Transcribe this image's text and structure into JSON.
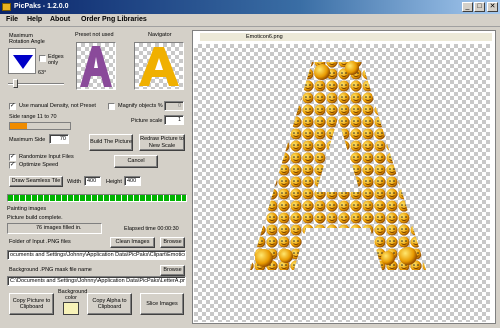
{
  "window": {
    "title": "PicPaks - 1.2.0.0",
    "min": "_",
    "max": "□",
    "close": "✕"
  },
  "menu": [
    "File",
    "Help",
    "About",
    "Order Png Libraries"
  ],
  "rotation": {
    "label": "Maximum Rotation Angle",
    "value": "63°",
    "edges_only": "Edges only"
  },
  "preset": {
    "label": "Preset not used"
  },
  "navigator": {
    "label": "Navigator"
  },
  "options": {
    "manual_density": "Use manual Density, not Preset",
    "magnify": "Magnify objects %",
    "magnify_value": "0",
    "side_range": "Side range 11 to 70",
    "picture_scale_label": "Picture scale",
    "picture_scale_value": "1",
    "max_side_label": "Maximum Side",
    "max_side_value": "70",
    "randomize": "Randomize Input Files",
    "optimize": "Optimize Speed",
    "side_range_fill": 0.28
  },
  "buttons": {
    "build": "Build The Picture",
    "redraw": "Redraw Picture to New Scale",
    "cancel": "Cancel",
    "seamless": "Draw Seamless Tile",
    "clean": "Clean Images",
    "browse1": "Browse",
    "browse2": "Browse",
    "copy_picture": "Copy Picture to Clipboard",
    "copy_alpha": "Copy Alpha to Clipboard",
    "slice": "Slice Images"
  },
  "tile": {
    "width_label": "Width",
    "width_value": "400",
    "height_label": "Height",
    "height_value": "400"
  },
  "status": {
    "painting": "Painting images",
    "complete": "Picture build complete.",
    "filled": "76 images filled in.",
    "elapsed": "Elapsed time 00:00:30",
    "progress": 1.0
  },
  "folders": {
    "input_label": "Folder of Input .PNG files",
    "input_value": "ocuments and Settings\\Johnny\\Application Data\\PicPaks\\Clipart\\Emoticons",
    "mask_label": "Background .PNG mask file name",
    "mask_value": "C:\\Documents and Settings\\Johnny\\Application Data\\PicPaks\\LetterA.png"
  },
  "bg_color": {
    "label": "Background color",
    "color": "#f7f2b8"
  },
  "canvas": {
    "filename": "Emoticon6.png"
  },
  "colors": {
    "title_start": "#0a246a",
    "title_end": "#a6caf0",
    "progress_green": "#00b400",
    "slider_orange": "#f08c00",
    "triangle_blue": "#0000c8"
  }
}
